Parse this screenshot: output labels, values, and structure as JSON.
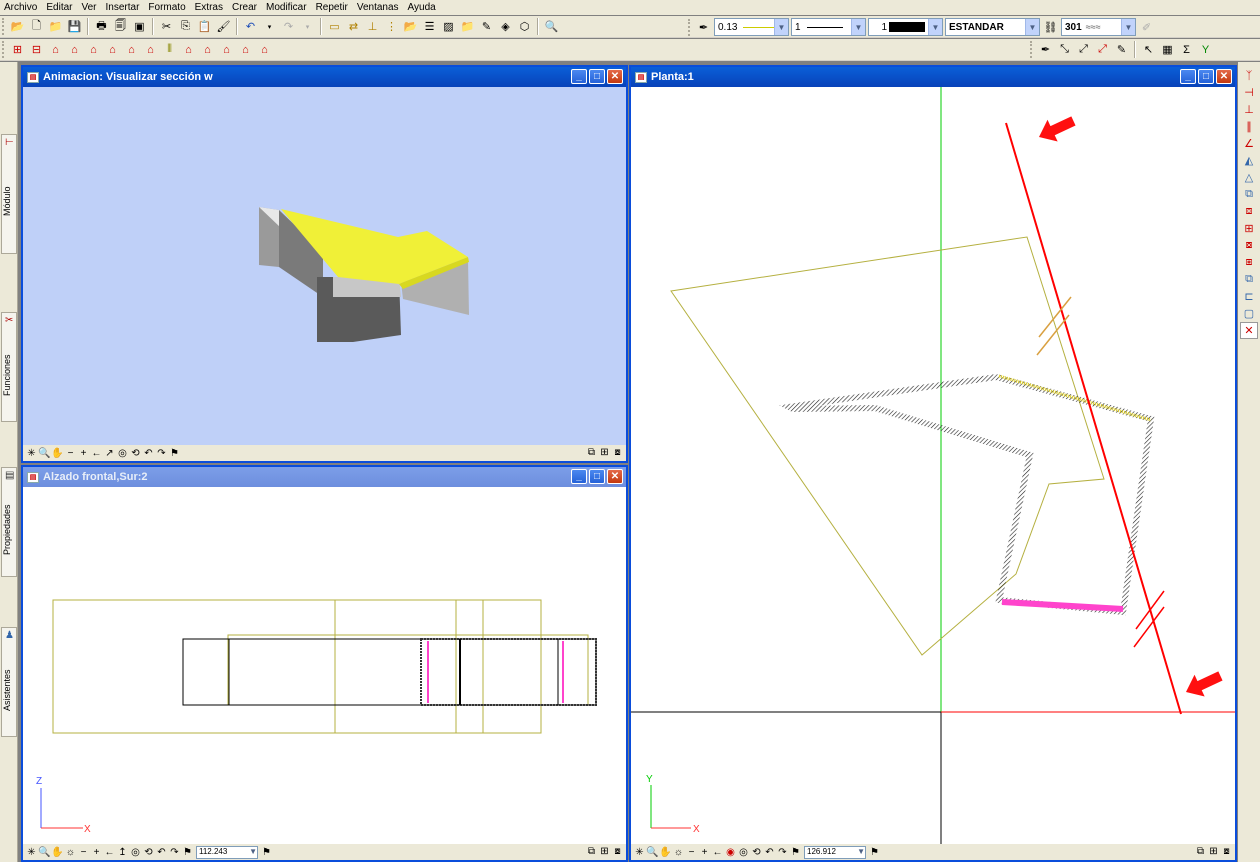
{
  "menu": [
    "Archivo",
    "Editar",
    "Ver",
    "Insertar",
    "Formato",
    "Extras",
    "Crear",
    "Modificar",
    "Repetir",
    "Ventanas",
    "Ayuda"
  ],
  "props": {
    "lineweight": "0.13",
    "linetype": "1",
    "color": "1",
    "style": "ESTANDAR",
    "hatch": "301"
  },
  "dock_tabs": [
    "Módulo",
    "Funciones",
    "Propiedades",
    "Asistentes"
  ],
  "windows": {
    "anim": {
      "title": "Animacion: Visualizar sección w"
    },
    "planta": {
      "title": "Planta:1",
      "zoom": "126.912",
      "axis_x": "X",
      "axis_y": "Y"
    },
    "alzado": {
      "title": "Alzado frontal,Sur:2",
      "zoom": "112.243",
      "axis_x": "X",
      "axis_z": "Z"
    }
  },
  "icons": {
    "window_minimize": "_",
    "window_maximize": "□",
    "window_close": "✕"
  },
  "colors": {
    "title_active": "#0842b9",
    "anim_bg": "#bfd0f8",
    "section_line": "#ff0000",
    "outline_olive": "#b5b040",
    "wall_magenta": "#ff44cc"
  }
}
